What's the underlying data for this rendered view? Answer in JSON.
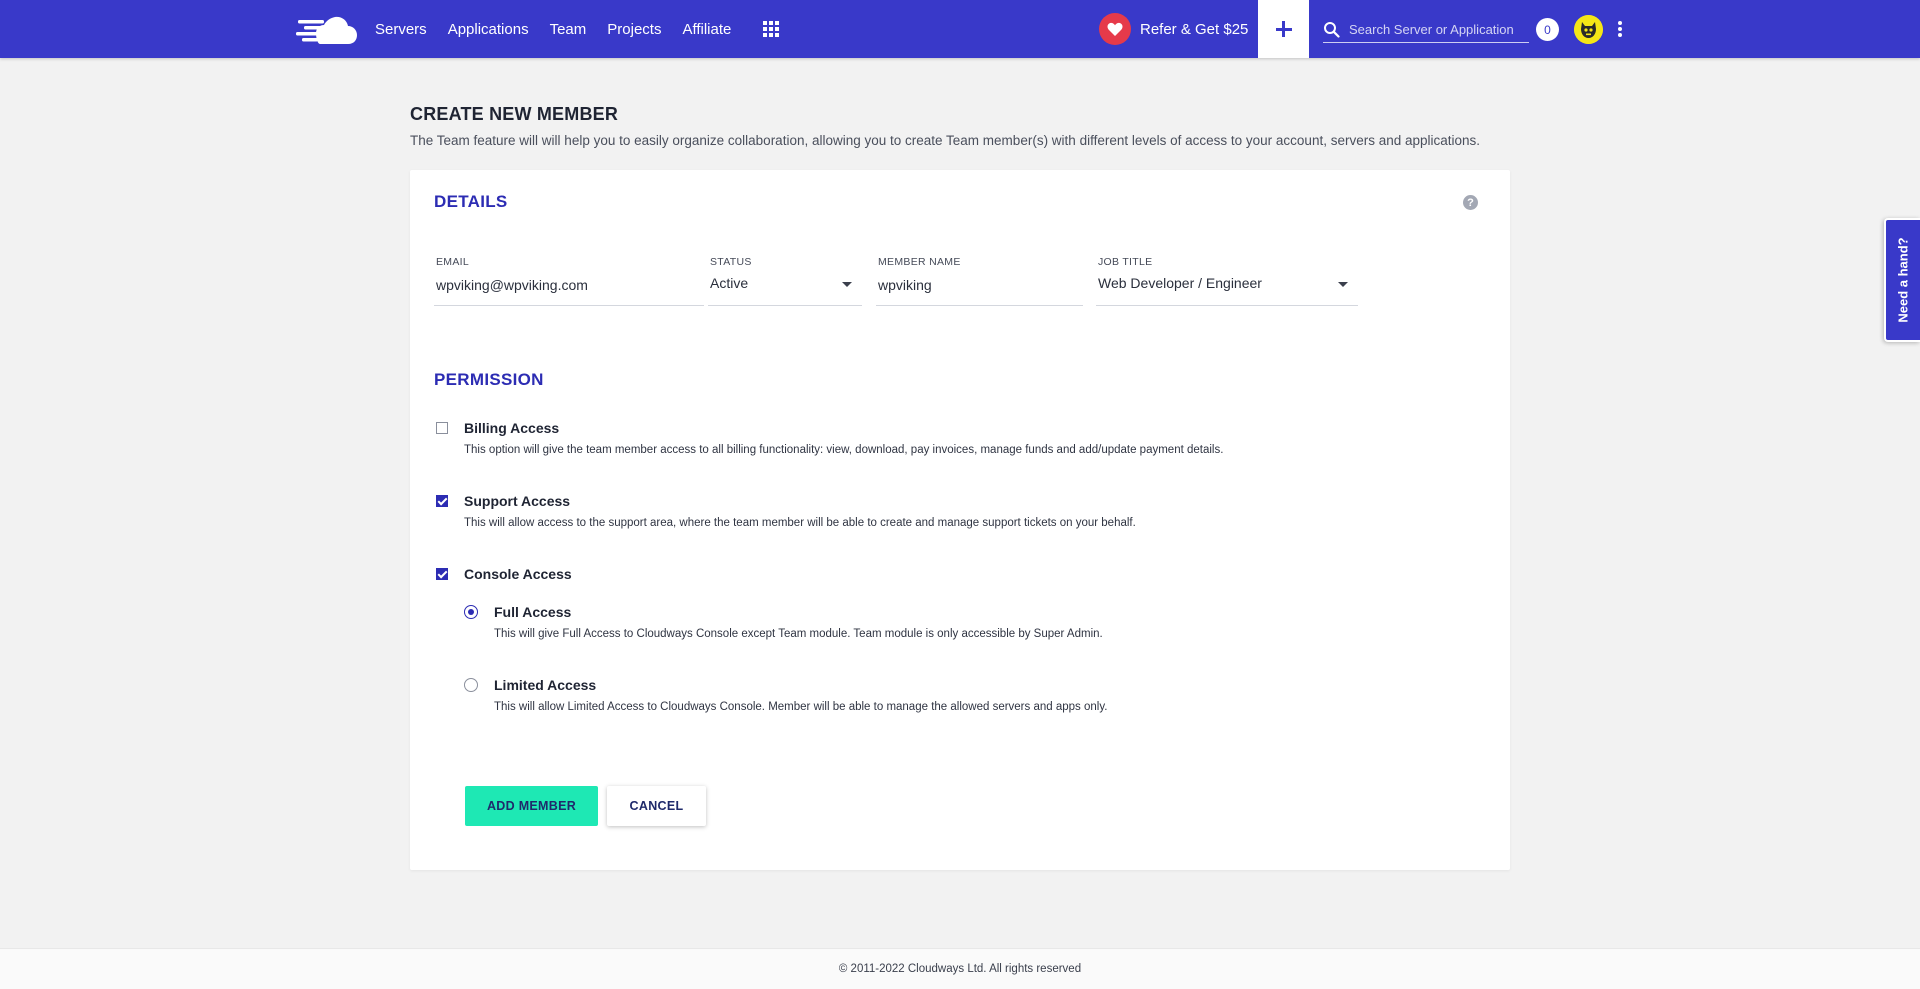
{
  "nav": {
    "items": [
      "Servers",
      "Applications",
      "Team",
      "Projects",
      "Affiliate"
    ],
    "refer_label": "Refer & Get $25",
    "search_placeholder": "Search Server or Application",
    "notification_count": "0"
  },
  "page": {
    "title": "CREATE NEW MEMBER",
    "description": "The Team feature will will help you to easily organize collaboration, allowing you to create Team member(s) with different levels of access to your account, servers and applications."
  },
  "details": {
    "section_title": "DETAILS",
    "help": "?",
    "email": {
      "label": "EMAIL",
      "value": "wpviking@wpviking.com"
    },
    "status": {
      "label": "STATUS",
      "value": "Active"
    },
    "member_name": {
      "label": "MEMBER NAME",
      "value": "wpviking"
    },
    "job_title": {
      "label": "JOB TITLE",
      "value": "Web Developer / Engineer"
    }
  },
  "permission": {
    "section_title": "PERMISSION",
    "billing": {
      "title": "Billing Access",
      "desc": "This option will give the team member access to all billing functionality: view, download, pay invoices, manage funds and add/update payment details.",
      "checked": false
    },
    "support": {
      "title": "Support Access",
      "desc": "This will allow access to the support area, where the team member will be able to create and manage support tickets on your behalf.",
      "checked": true
    },
    "console": {
      "title": "Console Access",
      "checked": true,
      "full": {
        "title": "Full Access",
        "desc": "This will give Full Access to Cloudways Console except Team module. Team module is only accessible by Super Admin.",
        "selected": true
      },
      "limited": {
        "title": "Limited Access",
        "desc": "This will allow Limited Access to Cloudways Console. Member will be able to manage the allowed servers and apps only.",
        "selected": false
      }
    }
  },
  "actions": {
    "add_label": "ADD MEMBER",
    "cancel_label": "CANCEL"
  },
  "side_tab": {
    "label": "Need a hand?"
  },
  "footer": {
    "copyright": "© 2011-2022 Cloudways Ltd. All rights reserved"
  },
  "colors": {
    "brand": "#3939c9",
    "accent": "#1ee8b4",
    "heading": "#2c2cb3"
  }
}
